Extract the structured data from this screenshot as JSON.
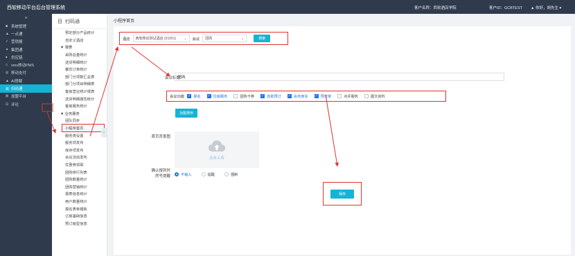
{
  "app": {
    "title": "西软移动平台后台管理系统",
    "customer_label": "客户名称：西软酒店学院",
    "customer_id_label": "客户ID：GCBTEST",
    "user_label": "▲ 你好，胡先生 ▾"
  },
  "sidebar": {
    "toggle": "≡",
    "items": [
      {
        "icon": "■",
        "label": "系统管理"
      },
      {
        "icon": "▲",
        "label": "一点通"
      },
      {
        "icon": "✓",
        "label": "营销报"
      },
      {
        "icon": "✦",
        "label": "集团通"
      },
      {
        "icon": "♦",
        "label": "供应链"
      },
      {
        "icon": "□",
        "label": "sms移动PMS"
      },
      {
        "icon": "◎",
        "label": "移动支付"
      },
      {
        "icon": "▲",
        "label": "AI搭载"
      },
      {
        "icon": "目",
        "label": "扫码通"
      },
      {
        "icon": "⊞",
        "label": "加盟平台"
      },
      {
        "icon": "☑",
        "label": "评论"
      }
    ]
  },
  "subnav": {
    "header": "扫码通",
    "items": [
      {
        "label": "预定部分产品统计",
        "type": "item"
      },
      {
        "label": "自定义酒店",
        "type": "item"
      },
      {
        "label": "▼ 报表",
        "type": "group"
      },
      {
        "label": "采购总量统计",
        "type": "item"
      },
      {
        "label": "送货明细统计",
        "type": "item"
      },
      {
        "label": "餐饮订单统计",
        "type": "item"
      },
      {
        "label": "部门分项数汇总表",
        "type": "item"
      },
      {
        "label": "部门分项目明细表",
        "type": "item"
      },
      {
        "label": "客房营业统计报表",
        "type": "item"
      },
      {
        "label": "送货明细属性统计",
        "type": "item"
      },
      {
        "label": "客房服务统计",
        "type": "item"
      },
      {
        "label": "▼ 业务服务",
        "type": "group"
      },
      {
        "label": "团队同步",
        "type": "item"
      },
      {
        "label": "小程序首页",
        "type": "sel"
      },
      {
        "label": "服务类设置",
        "type": "item"
      },
      {
        "label": "服务项发布",
        "type": "item"
      },
      {
        "label": "库存项发布",
        "type": "item"
      },
      {
        "label": "会议活动发布",
        "type": "item"
      },
      {
        "label": "优惠券领取",
        "type": "item"
      },
      {
        "label": "团购排行列表",
        "type": "item"
      },
      {
        "label": "团购数量统计",
        "type": "item"
      },
      {
        "label": "团购营销统计",
        "type": "item"
      },
      {
        "label": "报表信息统计",
        "type": "item"
      },
      {
        "label": "用户数量统计",
        "type": "item"
      },
      {
        "label": "报名表单模板",
        "type": "item"
      },
      {
        "label": "订房基础信息",
        "type": "item"
      },
      {
        "label": "预订房型信息",
        "type": "item"
      }
    ]
  },
  "main": {
    "breadcrumb": "小程序首页",
    "filter": {
      "hotel_label": "酒店",
      "hotel_value": "西软移动测试酒店 (01001)",
      "meeting_label": "会议",
      "meeting_value": "团购",
      "search_button": "搜索"
    },
    "form": {
      "title_label": "会议标题",
      "title_value": "团购",
      "func_label": "会议功能",
      "checkboxes": [
        {
          "label": "报名",
          "checked": true
        },
        {
          "label": "住房服务",
          "checked": true
        },
        {
          "label": "团购卡券",
          "checked": false
        },
        {
          "label": "自助预订",
          "checked": true
        },
        {
          "label": "会务用车",
          "checked": true
        },
        {
          "label": "预付单",
          "checked": true
        },
        {
          "label": "点评服务",
          "checked": false
        },
        {
          "label": "图文资料",
          "checked": false
        }
      ],
      "func_sort_button": "功能排序",
      "bg_label": "首页背景图",
      "upload_text": "点击上传",
      "notice_label_1": "确认报到时",
      "notice_label_2": "房号提醒",
      "radios": [
        {
          "label": "不输入",
          "checked": true
        },
        {
          "label": "提醒",
          "checked": false
        },
        {
          "label": "强制",
          "checked": false
        }
      ],
      "save_button": "保存"
    }
  }
}
